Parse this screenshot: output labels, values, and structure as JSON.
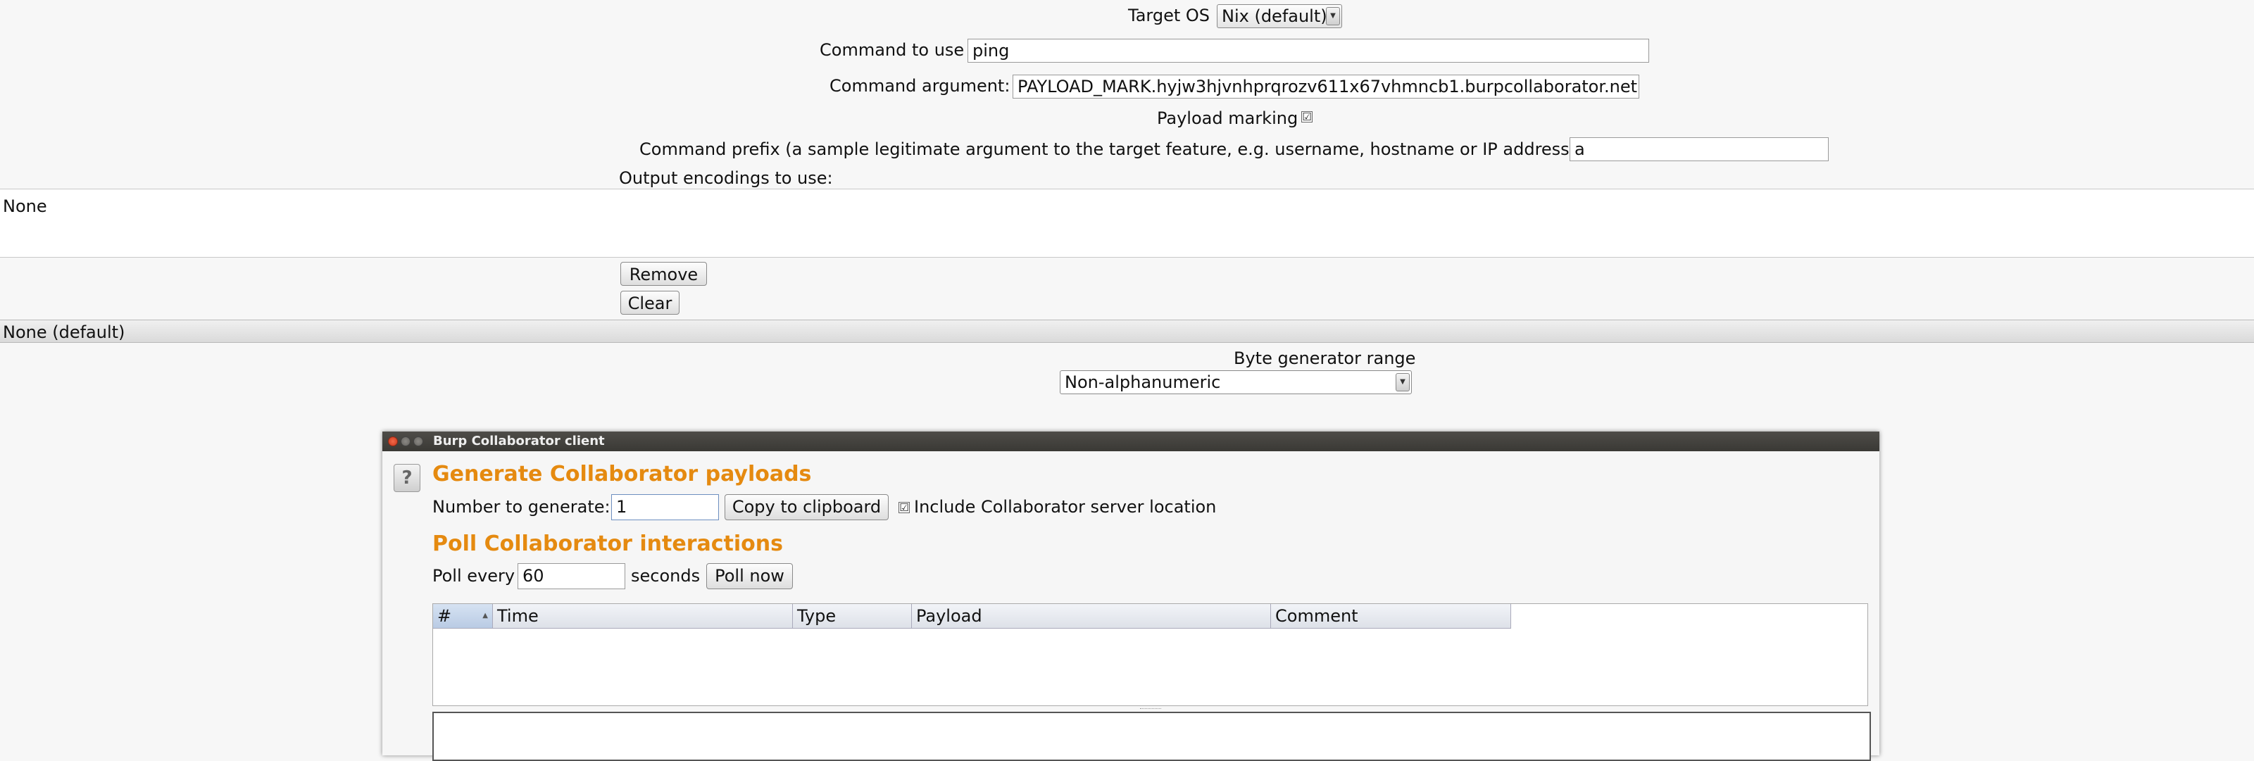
{
  "target_os": {
    "label": "Target OS",
    "value": "Nix (default)"
  },
  "command": {
    "label": "Command to use",
    "value": "ping"
  },
  "argument": {
    "label": "Command argument:",
    "value": "PAYLOAD_MARK.hyjw3hjvnhprqrozv611x67vhmncb1.burpcollaborator.net"
  },
  "payload_marking": {
    "label": "Payload marking",
    "checked": true,
    "check_glyph": "☑"
  },
  "prefix": {
    "label": "Command prefix (a sample legitimate argument to the target feature, e.g. username, hostname or IP address)",
    "value": "a"
  },
  "encodings": {
    "label": "Output encodings to use:",
    "list_items": [
      "None"
    ],
    "remove_label": "Remove",
    "clear_label": "Clear",
    "selected_combo": "None (default)"
  },
  "byte_range": {
    "label": "Byte generator range",
    "value": "Non-alphanumeric"
  },
  "collaborator": {
    "window_title": "Burp Collaborator client",
    "help_glyph": "?",
    "generate_heading": "Generate Collaborator payloads",
    "number_label": "Number to generate:",
    "number_value": "1",
    "copy_label": "Copy to clipboard",
    "include_checked": true,
    "include_label": "Include Collaborator server location",
    "poll_heading": "Poll Collaborator interactions",
    "poll_every_label": "Poll every",
    "poll_value": "60",
    "seconds_label": "seconds",
    "poll_now_label": "Poll now",
    "table_columns": [
      "#",
      "Time",
      "Type",
      "Payload",
      "Comment"
    ],
    "accent_color": "#e58a10"
  }
}
